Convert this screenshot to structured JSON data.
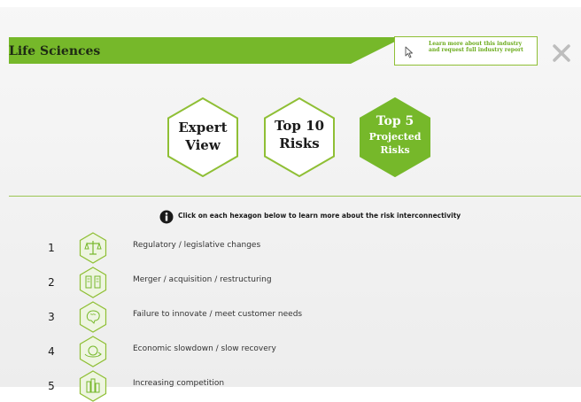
{
  "header": {
    "title": "Life Sciences",
    "accent_color": "#76b82a",
    "learn_more_text": "Learn more about this industry and request full industry report",
    "close_icon": "close-icon"
  },
  "tabs": [
    {
      "line1": "Expert",
      "line2": "View",
      "line3": "",
      "active": false
    },
    {
      "line1": "Top 10",
      "line2": "Risks",
      "line3": "",
      "active": false
    },
    {
      "line1": "Top 5",
      "line2": "Projected",
      "line3": "Risks",
      "active": true
    }
  ],
  "info": {
    "icon": "info-icon",
    "text": "Click on each hexagon below to learn more about the risk interconnectivity"
  },
  "risks": [
    {
      "number": "1",
      "label": "Regulatory / legislative changes",
      "icon": "scales-icon"
    },
    {
      "number": "2",
      "label": "Merger / acquisition / restructuring",
      "icon": "merger-icon"
    },
    {
      "number": "3",
      "label": "Failure to innovate / meet customer needs",
      "icon": "brain-icon"
    },
    {
      "number": "4",
      "label": "Economic slowdown / slow recovery",
      "icon": "economy-icon"
    },
    {
      "number": "5",
      "label": "Increasing competition",
      "icon": "competition-icon"
    }
  ]
}
